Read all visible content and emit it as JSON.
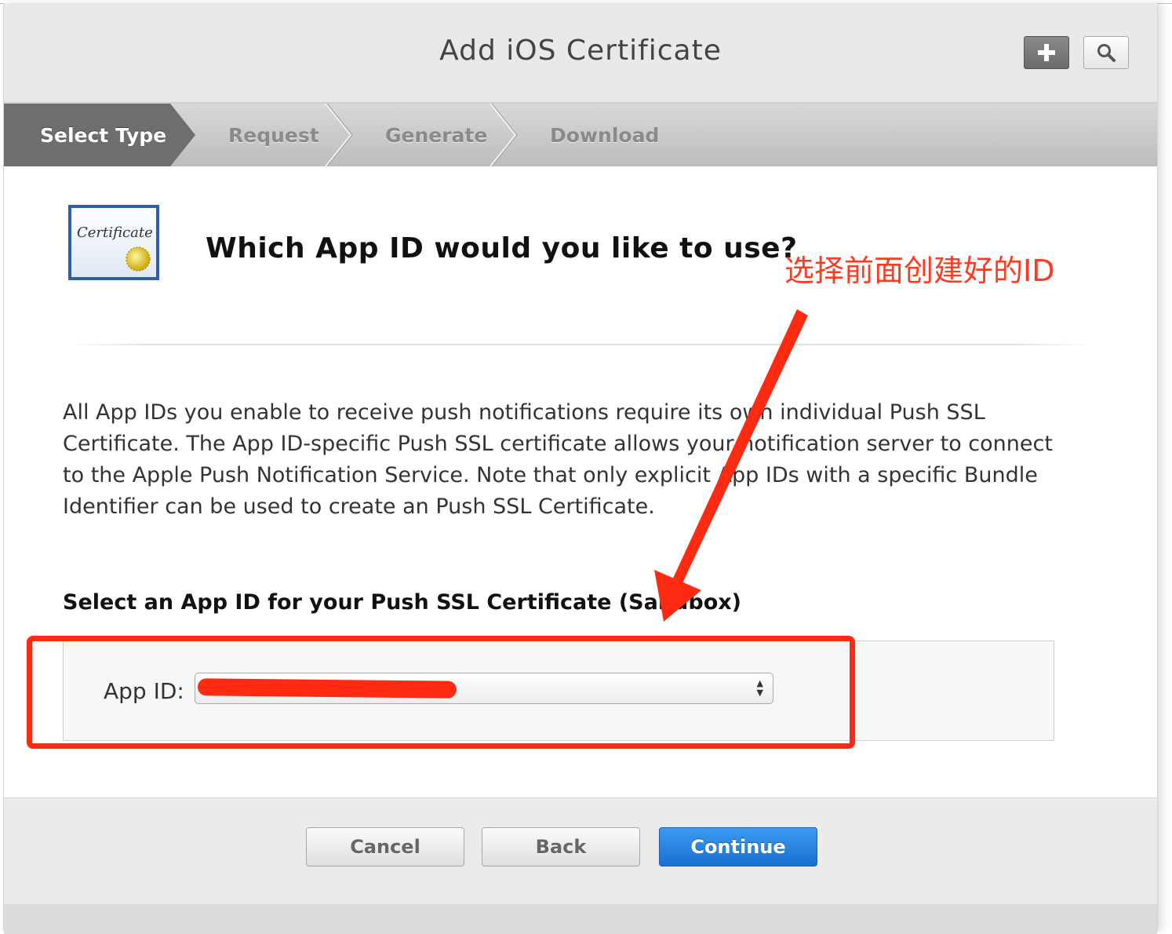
{
  "header": {
    "title": "Add iOS Certificate",
    "add_icon": "plus-icon",
    "search_icon": "search-icon"
  },
  "steps": [
    {
      "label": "Select Type",
      "active": true
    },
    {
      "label": "Request",
      "active": false
    },
    {
      "label": "Generate",
      "active": false
    },
    {
      "label": "Download",
      "active": false
    }
  ],
  "main": {
    "certificate_icon_text": "Certificate",
    "question": "Which App ID would you like to use?",
    "annotation": "选择前面创建好的ID",
    "description": "All App IDs you enable to receive push notifications require its own individual Push SSL Certificate. The App ID-specific Push SSL certificate allows your notification server to connect to the Apple Push Notification Service. Note that only explicit App IDs with a specific Bundle Identifier can be used to create an Push SSL Certificate.",
    "select_heading": "Select an App ID for your Push SSL Certificate (Sandbox)",
    "app_id_label": "App ID:",
    "app_id_value": ""
  },
  "footer": {
    "cancel": "Cancel",
    "back": "Back",
    "continue": "Continue"
  },
  "colors": {
    "annotation_red": "#ff2a12",
    "continue_blue": "#1a6fd0"
  }
}
